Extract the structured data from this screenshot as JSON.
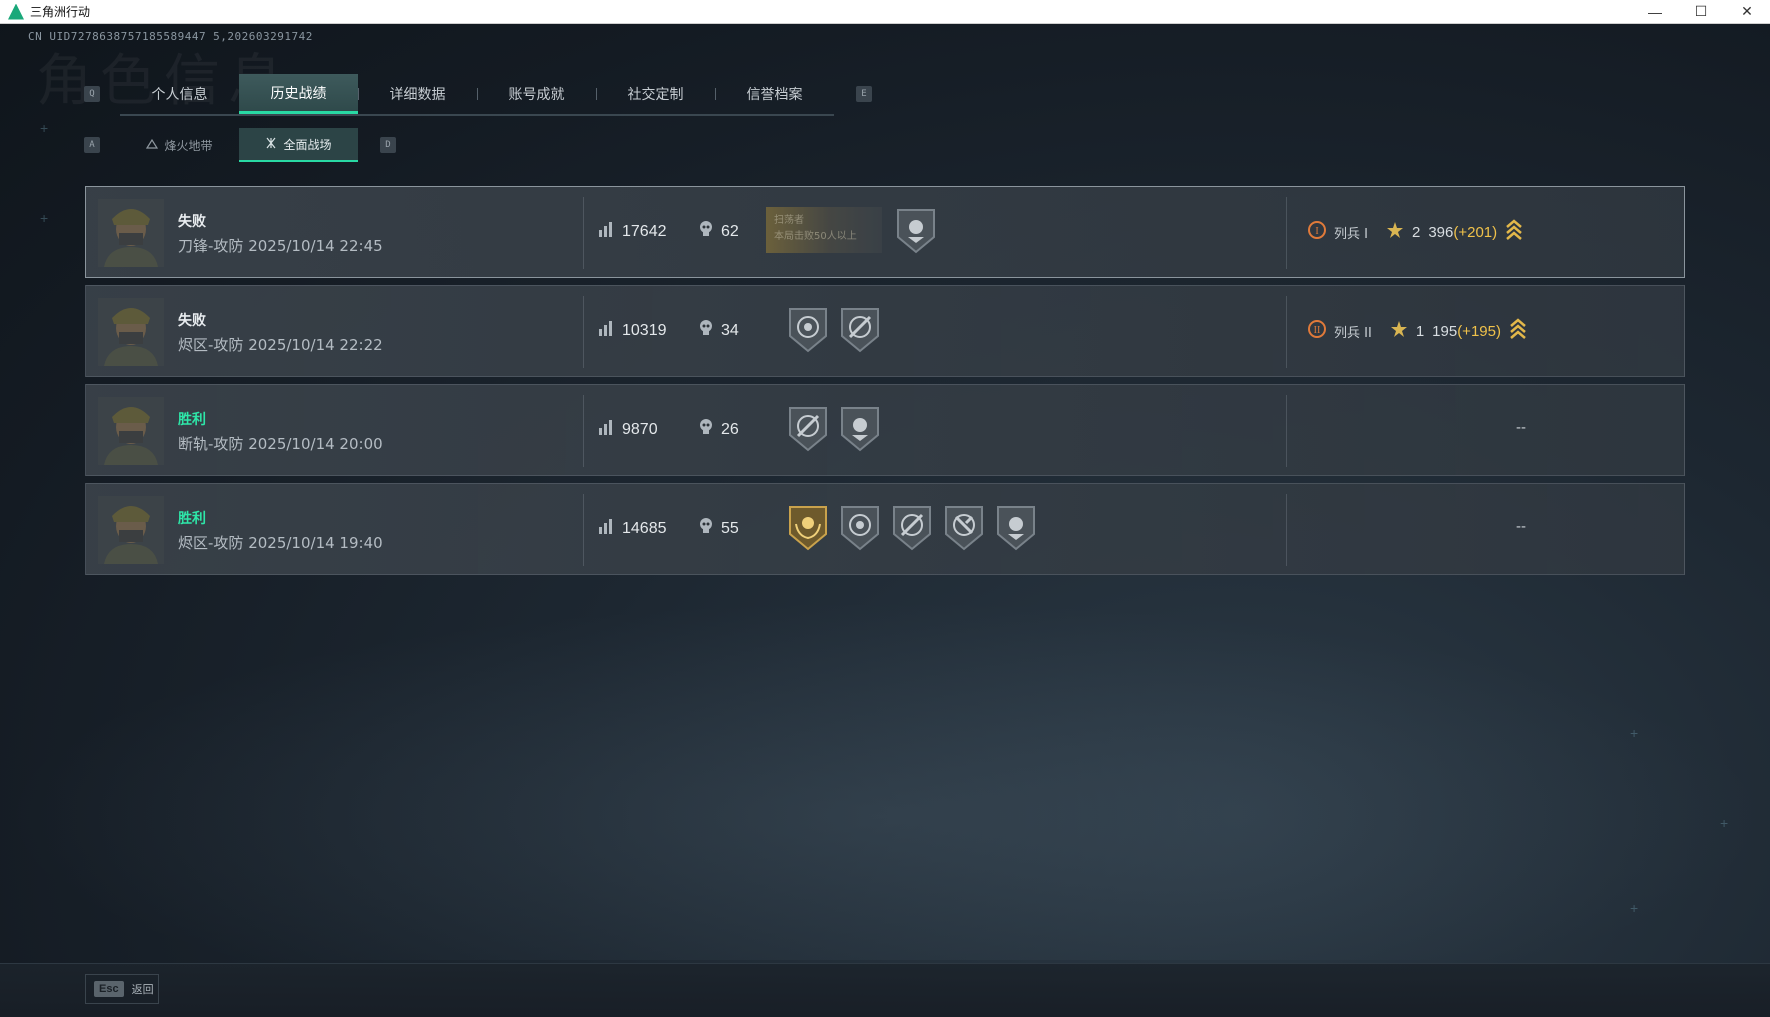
{
  "window": {
    "title": "三角洲行动",
    "minimize": "—",
    "maximize": "☐",
    "close": "✕"
  },
  "uid_text": "CN UID7278638757185589447 5,202603291742",
  "bg_title": "角色信息",
  "tabs": {
    "key_left": "Q",
    "key_right": "E",
    "items": [
      {
        "label": "个人信息"
      },
      {
        "label": "历史战绩"
      },
      {
        "label": "详细数据"
      },
      {
        "label": "账号成就"
      },
      {
        "label": "社交定制"
      },
      {
        "label": "信誉档案"
      }
    ],
    "active_index": 1
  },
  "subtabs": {
    "key_left": "A",
    "key_right": "D",
    "items": [
      {
        "label": "烽火地带",
        "icon": "radar-icon"
      },
      {
        "label": "全面战场",
        "icon": "crossed-arrows-icon"
      }
    ],
    "active_index": 1
  },
  "matches": [
    {
      "result": "失败",
      "win": false,
      "map_mode": "刀锋-攻防",
      "datetime": "2025/10/14 22:45",
      "score": "17642",
      "kills": "62",
      "banner": {
        "line1": "扫荡者",
        "line2": "本局击败50人以上"
      },
      "medals": [
        "skull-shield-icon"
      ],
      "rank": {
        "roman": "I",
        "name": "列兵 I",
        "stars": "2",
        "points": "396",
        "delta": "(+201)"
      }
    },
    {
      "result": "失败",
      "win": false,
      "map_mode": "烬区-攻防",
      "datetime": "2025/10/14 22:22",
      "score": "10319",
      "kills": "34",
      "medals": [
        "crosshair-skull-icon",
        "crossed-rifle-icon"
      ],
      "rank": {
        "roman": "II",
        "name": "列兵 II",
        "stars": "1",
        "points": "195",
        "delta": "(+195)"
      }
    },
    {
      "result": "胜利",
      "win": true,
      "map_mode": "断轨-攻防",
      "datetime": "2025/10/14 20:00",
      "score": "9870",
      "kills": "26",
      "medals": [
        "crossed-rifle-icon",
        "skull-shield-icon"
      ],
      "rank_empty": "--"
    },
    {
      "result": "胜利",
      "win": true,
      "map_mode": "烬区-攻防",
      "datetime": "2025/10/14 19:40",
      "score": "14685",
      "kills": "55",
      "medals": [
        "gold-wreath-icon",
        "crosshair-skull-icon",
        "crossed-rifle-icon",
        "wrench-rifle-icon",
        "skull-shield-icon"
      ],
      "rank_empty": "--"
    }
  ],
  "bottom": {
    "esc_key": "Esc",
    "esc_label": "返回"
  },
  "colors": {
    "accent": "#29d9a4",
    "win": "#2ee6a8",
    "delta": "#f0c24a",
    "rank_icon": "#e07a3a"
  }
}
